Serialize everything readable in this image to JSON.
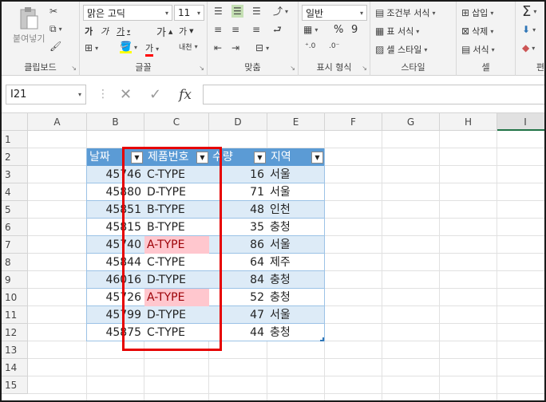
{
  "ribbon": {
    "clipboard": {
      "paste_label": "붙여넣기",
      "group_label": "클립보드"
    },
    "font": {
      "font_name": "맑은 고딕",
      "font_size": "11",
      "bold": "가",
      "italic": "가",
      "underline": "가",
      "grow": "가",
      "shrink": "가",
      "font_color_label": "가",
      "phonetic_label": "내천",
      "group_label": "글꼴"
    },
    "alignment": {
      "group_label": "맞춤"
    },
    "number": {
      "format": "일반",
      "percent": "%",
      "comma": "9",
      "group_label": "표시 형식"
    },
    "styles": {
      "conditional": "조건부 서식",
      "table_format": "표 서식",
      "cell_styles": "셀 스타일",
      "group_label": "스타일"
    },
    "cells": {
      "insert": "삽입",
      "delete": "삭제",
      "format": "서식",
      "group_label": "셀"
    },
    "editing": {
      "sigma": "Σ",
      "group_label": "편"
    }
  },
  "formula_bar": {
    "name_box": "I21",
    "fx": "fx",
    "value": ""
  },
  "columns": [
    "A",
    "B",
    "C",
    "D",
    "E",
    "F",
    "G",
    "H",
    "I"
  ],
  "active_column": "I",
  "rows": [
    "1",
    "2",
    "3",
    "4",
    "5",
    "6",
    "7",
    "8",
    "9",
    "10",
    "11",
    "12",
    "13",
    "14",
    "15"
  ],
  "table": {
    "headers": [
      "날짜",
      "제품번호",
      "수량",
      "지역"
    ],
    "data": [
      {
        "date": "45746",
        "product": "C-TYPE",
        "qty": "16",
        "region": "서울",
        "highlight": false
      },
      {
        "date": "45880",
        "product": "D-TYPE",
        "qty": "71",
        "region": "서울",
        "highlight": false
      },
      {
        "date": "45851",
        "product": "B-TYPE",
        "qty": "48",
        "region": "인천",
        "highlight": false
      },
      {
        "date": "45815",
        "product": "B-TYPE",
        "qty": "35",
        "region": "충청",
        "highlight": false
      },
      {
        "date": "45740",
        "product": "A-TYPE",
        "qty": "86",
        "region": "서울",
        "highlight": true
      },
      {
        "date": "45844",
        "product": "C-TYPE",
        "qty": "64",
        "region": "제주",
        "highlight": false
      },
      {
        "date": "46016",
        "product": "D-TYPE",
        "qty": "84",
        "region": "충청",
        "highlight": false
      },
      {
        "date": "45726",
        "product": "A-TYPE",
        "qty": "52",
        "region": "충청",
        "highlight": true
      },
      {
        "date": "45799",
        "product": "D-TYPE",
        "qty": "47",
        "region": "서울",
        "highlight": false
      },
      {
        "date": "45875",
        "product": "C-TYPE",
        "qty": "44",
        "region": "충청",
        "highlight": false
      }
    ]
  },
  "colors": {
    "header_fill": "#5b9bd5",
    "band_fill": "#ddebf7",
    "duplicate_fill": "#ffc7ce",
    "duplicate_text": "#9c0006",
    "annotation_box": "#e60000"
  }
}
